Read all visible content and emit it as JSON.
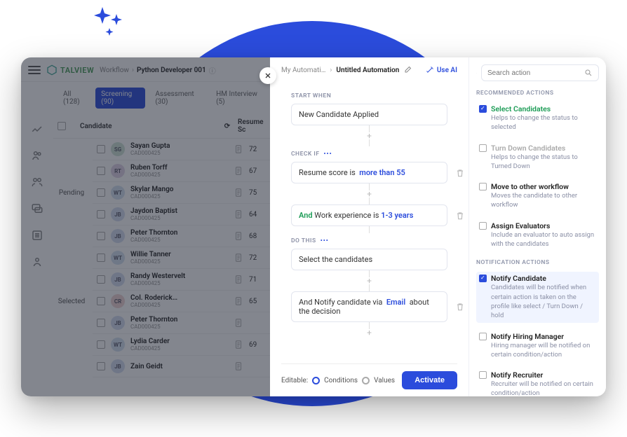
{
  "header": {
    "brand": "TALVIEW",
    "crumb1": "Workflow",
    "crumb2": "Python Developer 001"
  },
  "tabs": {
    "all": "All (128)",
    "screening": "Screening (90)",
    "assessment": "Assessment (30)",
    "interview": "HM Interview (5)"
  },
  "table": {
    "candidate_col": "Candidate",
    "resume_col": "Resume Sc",
    "status_pending": "Pending",
    "status_selected": "Selected"
  },
  "candidates": [
    {
      "initials": "SG",
      "name": "Sayan Gupta",
      "id": "CAD000425",
      "score": "72",
      "color": "#cfe3d6"
    },
    {
      "initials": "RT",
      "name": "Ruben Torff",
      "id": "CAD000425",
      "score": "67",
      "color": "#e0d3e6"
    },
    {
      "initials": "WT",
      "name": "Skylar Mango",
      "id": "CAD000425",
      "score": "75",
      "color": "#d3e0ef"
    },
    {
      "initials": "JB",
      "name": "Jaydon Baptist",
      "id": "CAD000425",
      "score": "64",
      "color": "#d3dbef"
    },
    {
      "initials": "JB",
      "name": "Peter Thornton",
      "id": "CAD000425",
      "score": "68",
      "color": "#d3dbef"
    },
    {
      "initials": "WT",
      "name": "Willie Tanner",
      "id": "CAD000425",
      "score": "72",
      "color": "#d3e0ef"
    },
    {
      "initials": "JB",
      "name": "Randy Westervelt",
      "id": "CAD000425",
      "score": "71",
      "color": "#d3dbef"
    },
    {
      "initials": "CR",
      "name": "Col. Roderick…",
      "id": "CAD000425",
      "score": "65",
      "color": "#efd3d3"
    },
    {
      "initials": "JB",
      "name": "Peter Thornton",
      "id": "CAD000425",
      "score": "",
      "color": "#d3dbef"
    },
    {
      "initials": "WT",
      "name": "Lydia Carder",
      "id": "CAD000425",
      "score": "69",
      "color": "#d3e0ef"
    },
    {
      "initials": "JB",
      "name": "Zain Geidt",
      "id": "",
      "score": "",
      "color": "#d3dbef"
    }
  ],
  "automation": {
    "crumb1": "My Automati…",
    "title": "Untitled Automation",
    "use_ai": "Use AI",
    "start_when_label": "START WHEN",
    "trigger": "New Candidate Applied",
    "check_if_label": "CHECK IF",
    "cond1_pre": "Resume score is",
    "cond1_val": "more than 55",
    "cond2_and": "And",
    "cond2_pre": "Work experience is",
    "cond2_val": "1-3 years",
    "do_this_label": "DO THIS",
    "action1": "Select the candidates",
    "action2_pre": "And Notify candidate via",
    "action2_val": "Email",
    "action2_post": "about the decision",
    "editable_label": "Editable:",
    "radio1": "Conditions",
    "radio2": "Values",
    "activate": "Activate"
  },
  "actions": {
    "search_placeholder": "Search action",
    "rec_title": "RECOMMENDED ACTIONS",
    "notif_title": "NOTIFICATION ACTIONS",
    "recommended": [
      {
        "title": "Select Candidates",
        "desc": "Helps to change the status to selected",
        "checked": true,
        "style": "green"
      },
      {
        "title": "Turn Down Candidates",
        "desc": "Helps to change the status to Turned Down",
        "checked": false,
        "style": "grey"
      },
      {
        "title": "Move to other workflow",
        "desc": "Moves the candidate to other workflow",
        "checked": false,
        "style": ""
      },
      {
        "title": "Assign Evaluators",
        "desc": "Include an evaluator to auto assign with the candidates",
        "checked": false,
        "style": ""
      }
    ],
    "notification": [
      {
        "title": "Notify Candidate",
        "desc": "Candidates will be notified when certain action is taken on the profile like select / Turn Down / hold",
        "checked": true,
        "style": "",
        "hl": true
      },
      {
        "title": "Notify Hiring Manager",
        "desc": "Hiring manager will be notified on certain condition/action",
        "checked": false,
        "style": ""
      },
      {
        "title": "Notify Recruiter",
        "desc": "Recruiter will be notified on certain condition/action",
        "checked": false,
        "style": ""
      }
    ]
  }
}
